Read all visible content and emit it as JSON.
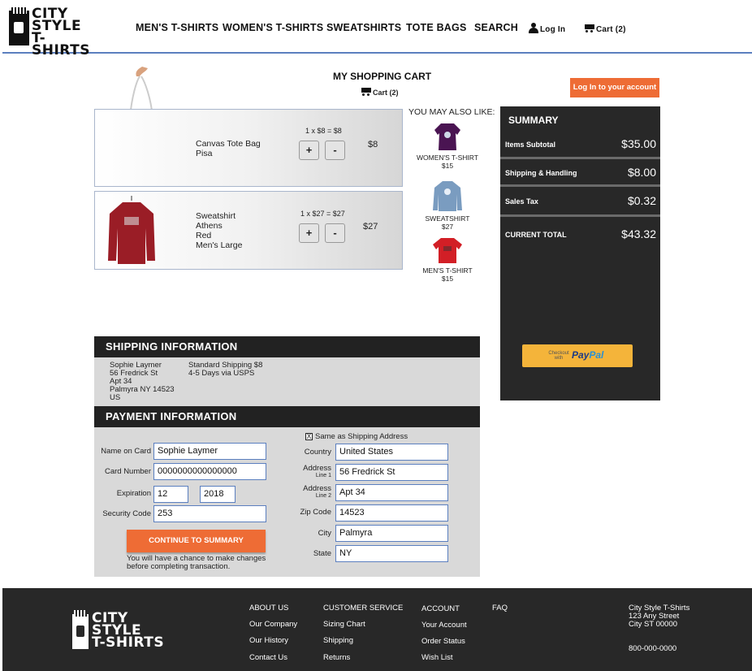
{
  "brand": {
    "logo_line1": "CITY",
    "logo_line2": "STYLE",
    "logo_line3": "T-SHIRTS"
  },
  "nav": {
    "items": [
      "MEN'S T-SHIRTS",
      "WOMEN'S T-SHIRTS",
      "SWEATSHIRTS",
      "TOTE BAGS",
      "SEARCH"
    ],
    "login": "Log In",
    "cart": "Cart (2)"
  },
  "cart": {
    "title": "MY SHOPPING CART",
    "cart_link": "Cart (2)",
    "login_button": "Log In to your account",
    "items": [
      {
        "line1": "Canvas Tote Bag",
        "line2": "Pisa",
        "line3": "",
        "line4": "",
        "qty_text": "1 x $8 = $8",
        "plus": "+",
        "minus": "-",
        "price": "$8"
      },
      {
        "line1": "Sweatshirt",
        "line2": "Athens",
        "line3": "Red",
        "line4": "Men's Large",
        "qty_text": "1 x $27 = $27",
        "plus": "+",
        "minus": "-",
        "price": "$27"
      }
    ]
  },
  "recommendations": {
    "title": "YOU MAY ALSO LIKE:",
    "items": [
      {
        "name": "WOMEN'S T-SHIRT",
        "price": "$15",
        "color": "#4a1452"
      },
      {
        "name": "SWEATSHIRT",
        "price": "$27",
        "color": "#7a9cc0"
      },
      {
        "name": "MEN'S T-SHIRT",
        "price": "$15",
        "color": "#d21f26"
      }
    ]
  },
  "summary": {
    "title": "SUMMARY",
    "subtotal_label": "Items Subtotal",
    "subtotal": "$35.00",
    "shipping_label": "Shipping & Handling",
    "shipping": "$8.00",
    "tax_label": "Sales Tax",
    "tax": "$0.32",
    "total_label": "CURRENT TOTAL",
    "total": "$43.32",
    "paypal_small": "Checkout with",
    "paypal_pay": "Pay",
    "paypal_pal": "Pal"
  },
  "shipping": {
    "title": "SHIPPING INFORMATION",
    "name": "Sophie Laymer",
    "street": "56 Fredrick St",
    "apt": "Apt 34",
    "city_line": "Palmyra NY 14523",
    "country": "US",
    "method": "Standard Shipping $8",
    "eta": "4-5 Days via USPS"
  },
  "payment": {
    "title": "PAYMENT INFORMATION",
    "same_as_shipping": "Same as Shipping Address",
    "checkbox_mark": "X",
    "name_label": "Name on Card",
    "name_value": "Sophie Laymer",
    "card_label": "Card Number",
    "card_value": "0000000000000000",
    "exp_label": "Expiration",
    "exp_month": "12",
    "exp_year": "2018",
    "code_label": "Security Code",
    "code_value": "253",
    "country_label": "Country",
    "country_value": "United States",
    "addr1_label": "Address",
    "addr1_sub": "Line 1",
    "addr1_value": "56 Fredrick St",
    "addr2_label": "Address",
    "addr2_sub": "Line 2",
    "addr2_value": "Apt 34",
    "zip_label": "Zip Code",
    "zip_value": "14523",
    "city_label": "City",
    "city_value": "Palmyra",
    "state_label": "State",
    "state_value": "NY",
    "continue_button": "CONTINUE TO SUMMARY",
    "note_line1": "You will have a chance to make changes",
    "note_line2": "before completing transaction."
  },
  "footer": {
    "about": {
      "head": "ABOUT US",
      "links": [
        "Our Company",
        "Our History",
        "Contact Us"
      ]
    },
    "service": {
      "head": "CUSTOMER SERVICE",
      "links": [
        "Sizing Chart",
        "Shipping",
        "Returns"
      ]
    },
    "account": {
      "head": "ACCOUNT",
      "links": [
        "Your Account",
        "Order Status",
        "Wish List"
      ]
    },
    "faq": "FAQ",
    "address": {
      "line1": "City Style T-Shirts",
      "line2": "123 Any Street",
      "line3": "City ST 00000",
      "phone": "800-000-0000"
    }
  }
}
